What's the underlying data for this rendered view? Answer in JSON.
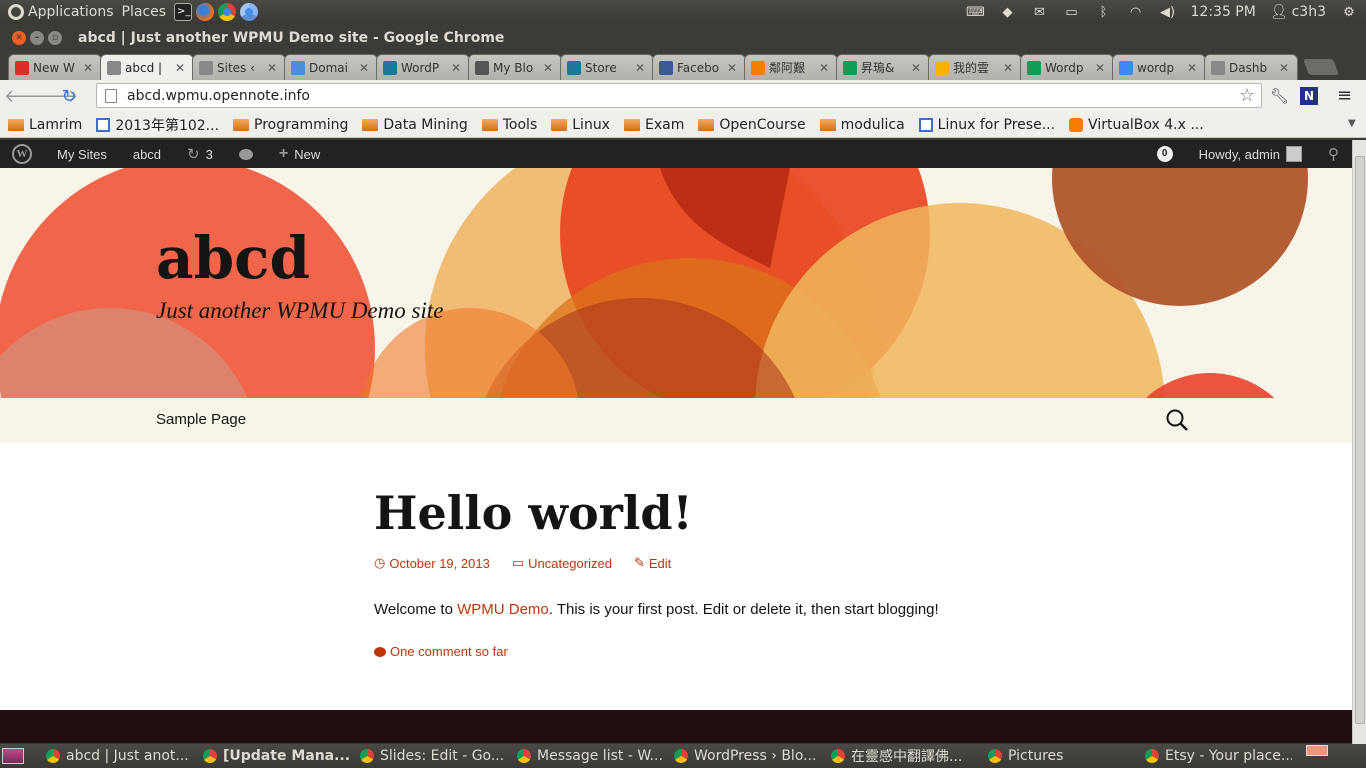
{
  "system_panel": {
    "applications": "Applications",
    "places": "Places",
    "clock": "12:35 PM",
    "user": "c3h3"
  },
  "window": {
    "title": "abcd | Just another WPMU Demo site - Google Chrome"
  },
  "tabs": [
    {
      "label": "New W",
      "favicon": "gmail",
      "color": "#d93025"
    },
    {
      "label": "abcd |",
      "favicon": "page",
      "color": "#888888",
      "active": true
    },
    {
      "label": "Sites ‹",
      "favicon": "page",
      "color": "#888888"
    },
    {
      "label": "Domai",
      "favicon": "cloud",
      "color": "#4a90d9"
    },
    {
      "label": "WordP",
      "favicon": "wordpress",
      "color": "#21759b"
    },
    {
      "label": "My Blo",
      "favicon": "wordpress",
      "color": "#555555"
    },
    {
      "label": "Store",
      "favicon": "wordpress",
      "color": "#21759b"
    },
    {
      "label": "Facebo",
      "favicon": "facebook",
      "color": "#3b5998"
    },
    {
      "label": "鄰阿艱",
      "favicon": "blogger",
      "color": "#f57d00"
    },
    {
      "label": "昇瑦&",
      "favicon": "sheets",
      "color": "#0f9d58"
    },
    {
      "label": "我的雲",
      "favicon": "drive",
      "color": "#f4b400"
    },
    {
      "label": "Wordp",
      "favicon": "sheets",
      "color": "#0f9d58"
    },
    {
      "label": "wordp",
      "favicon": "google",
      "color": "#4285f4"
    },
    {
      "label": "Dashb",
      "favicon": "page",
      "color": "#888888"
    }
  ],
  "omnibox": {
    "url": "abcd.wpmu.opennote.info"
  },
  "bookmarks": [
    {
      "label": "Lamrim",
      "type": "folder"
    },
    {
      "label": "2013年第102...",
      "type": "page"
    },
    {
      "label": "Programming",
      "type": "folder"
    },
    {
      "label": "Data Mining",
      "type": "folder"
    },
    {
      "label": "Tools",
      "type": "folder"
    },
    {
      "label": "Linux",
      "type": "folder"
    },
    {
      "label": "Exam",
      "type": "folder"
    },
    {
      "label": "OpenCourse",
      "type": "folder"
    },
    {
      "label": "modulica",
      "type": "folder"
    },
    {
      "label": "Linux for Prese...",
      "type": "page"
    },
    {
      "label": "VirtualBox 4.x ...",
      "type": "blogger"
    }
  ],
  "adminbar": {
    "my_sites": "My Sites",
    "site": "abcd",
    "updates": "3",
    "new": "New",
    "notifications": "0",
    "howdy": "Howdy, admin"
  },
  "site": {
    "title": "abcd",
    "description": "Just another WPMU Demo site",
    "nav_item": "Sample Page"
  },
  "post": {
    "title": "Hello world!",
    "date": "October 19, 2013",
    "category": "Uncategorized",
    "edit": "Edit",
    "content_before": "Welcome to ",
    "content_link": "WPMU Demo",
    "content_after": ". This is your first post. Edit or delete it, then start blogging!",
    "comments": "One comment so far"
  },
  "taskbar": [
    {
      "label": "abcd | Just anot...",
      "bold": false
    },
    {
      "label": "[Update Mana...",
      "bold": true
    },
    {
      "label": "Slides: Edit - Go...",
      "bold": false
    },
    {
      "label": "Message list - W...",
      "bold": false
    },
    {
      "label": "WordPress › Blo...",
      "bold": false
    },
    {
      "label": "在靈感中翻譯佛...",
      "bold": false
    },
    {
      "label": "Pictures",
      "bold": false
    },
    {
      "label": "Etsy - Your place...",
      "bold": false
    }
  ],
  "colors": {
    "accent": "#bc360a",
    "adminbar": "#222222",
    "footer": "#220e10"
  }
}
